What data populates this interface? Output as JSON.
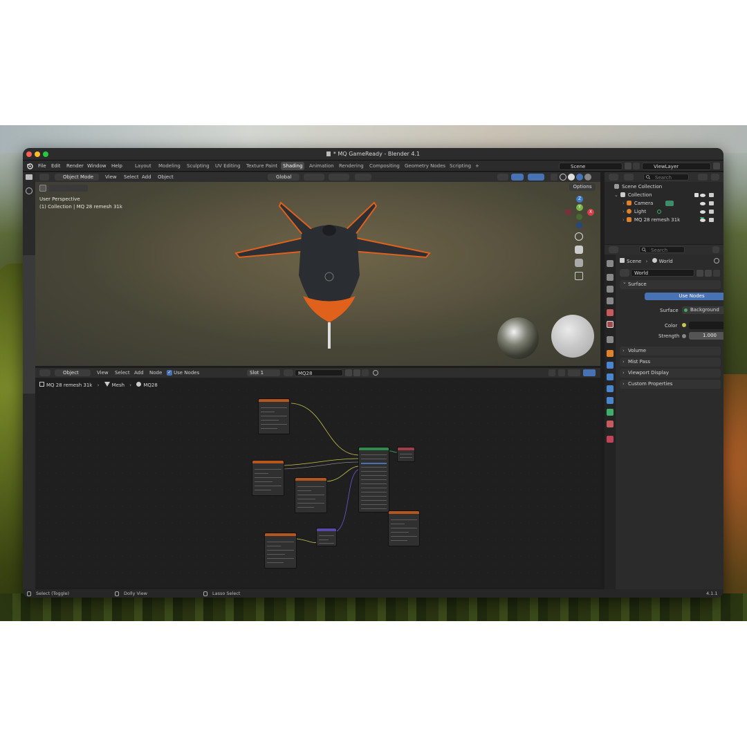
{
  "window": {
    "title": "* MQ GameReady - Blender 4.1"
  },
  "menu": [
    "File",
    "Edit",
    "Render",
    "Window",
    "Help"
  ],
  "workspaces": {
    "tabs": [
      "Layout",
      "Modeling",
      "Sculpting",
      "UV Editing",
      "Texture Paint",
      "Shading",
      "Animation",
      "Rendering",
      "Compositing",
      "Geometry Nodes",
      "Scripting"
    ],
    "active": "Shading",
    "add_label": "+"
  },
  "scene": {
    "name": "Scene",
    "view_layer": "ViewLayer"
  },
  "viewport": {
    "mode": "Object Mode",
    "menus": [
      "View",
      "Select",
      "Add",
      "Object"
    ],
    "orientation": "Global",
    "options_label": "Options",
    "perspective": "User Perspective",
    "collection_info": "(1) Collection | MQ 28 remesh 31k",
    "gizmo_z": "Z",
    "gizmo_y": "Y",
    "gizmo_x": "X"
  },
  "outliner": {
    "search_placeholder": "Search",
    "root": "Scene Collection",
    "collection": "Collection",
    "items": [
      "Camera",
      "Light",
      "MQ 28 remesh 31k"
    ]
  },
  "properties": {
    "search_placeholder": "Search",
    "breadcrumb_scene": "Scene",
    "breadcrumb_world": "World",
    "world_name": "World",
    "surface_panel": "Surface",
    "use_nodes_button": "Use Nodes",
    "surface_label": "Surface",
    "surface_value": "Background",
    "color_label": "Color",
    "strength_label": "Strength",
    "strength_value": "1.000",
    "collapsed_panels": [
      "Volume",
      "Mist Pass",
      "Viewport Display",
      "Custom Properties"
    ]
  },
  "node_editor": {
    "type": "Object",
    "menus": [
      "View",
      "Select",
      "Add",
      "Node"
    ],
    "use_nodes_label": "Use Nodes",
    "use_nodes_checked": true,
    "slot": "Slot 1",
    "material": "MQ28",
    "breadcrumb": [
      "MQ 28 remesh 31k",
      "Mesh",
      "MQ28"
    ]
  },
  "statusbar": {
    "items": [
      "Select (Toggle)",
      "Dolly View",
      "Lasso Select"
    ],
    "version": "4.1.1"
  },
  "colors": {
    "accent_blue": "#4772b3",
    "active_tab": "#4a4a4a",
    "orange_paint": "#e0611c",
    "node_green": "#2e8b4a",
    "node_orange": "#b4561e",
    "node_purple": "#5a4aa8",
    "node_red": "#a43a4a",
    "wire_yellow": "#c8c84a",
    "wire_purple": "#6a5adc",
    "traffic_red": "#fe5f57",
    "traffic_yellow": "#febc2e",
    "traffic_green": "#28c840"
  }
}
